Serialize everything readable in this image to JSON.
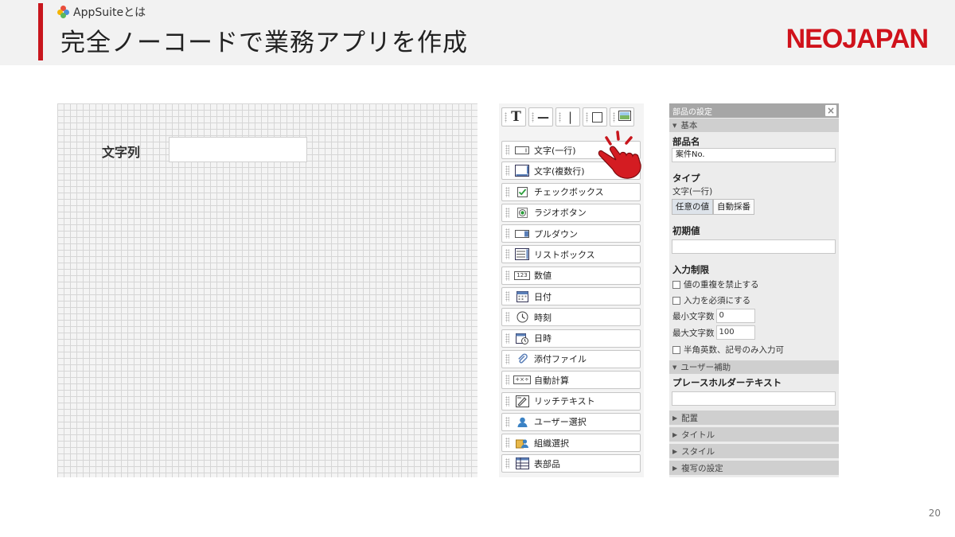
{
  "header": {
    "subtitle": "AppSuiteとは",
    "title": "完全ノーコードで業務アプリを作成",
    "brand": "NEOJAPAN"
  },
  "canvas": {
    "field_label": "文字列",
    "field_value": ""
  },
  "palette": {
    "tools": [
      {
        "name": "text-tool",
        "glyph": "T"
      },
      {
        "name": "hline-tool",
        "glyph": "—"
      },
      {
        "name": "vline-tool",
        "glyph": "|"
      },
      {
        "name": "box-tool",
        "glyph": "□"
      },
      {
        "name": "image-tool",
        "glyph": "▣"
      }
    ],
    "items": [
      {
        "label": "文字(一行)",
        "icon": "single-line-text-icon"
      },
      {
        "label": "文字(複数行)",
        "icon": "multi-line-text-icon"
      },
      {
        "label": "チェックボックス",
        "icon": "checkbox-icon"
      },
      {
        "label": "ラジオボタン",
        "icon": "radio-button-icon"
      },
      {
        "label": "プルダウン",
        "icon": "dropdown-icon"
      },
      {
        "label": "リストボックス",
        "icon": "listbox-icon"
      },
      {
        "label": "数値",
        "icon": "number-icon"
      },
      {
        "label": "日付",
        "icon": "calendar-icon"
      },
      {
        "label": "時刻",
        "icon": "clock-icon"
      },
      {
        "label": "日時",
        "icon": "datetime-icon"
      },
      {
        "label": "添付ファイル",
        "icon": "paperclip-icon"
      },
      {
        "label": "自動計算",
        "icon": "calculator-icon"
      },
      {
        "label": "リッチテキスト",
        "icon": "rich-text-icon"
      },
      {
        "label": "ユーザー選択",
        "icon": "user-icon"
      },
      {
        "label": "組織選択",
        "icon": "organization-icon"
      },
      {
        "label": "表部品",
        "icon": "table-icon"
      }
    ],
    "number_icon_text": "123",
    "calc_icon_text": "+×÷"
  },
  "props": {
    "title": "部品の設定",
    "close": "×",
    "sect_basic": "基本",
    "part_name_label": "部品名",
    "part_name_value": "案件No.",
    "type_label": "タイプ",
    "type_value": "文字(一行)",
    "type_options": [
      "任意の値",
      "自動採番"
    ],
    "initial_label": "初期値",
    "initial_value": "",
    "restrict_label": "入力制限",
    "chk_no_dup": "値の重複を禁止する",
    "chk_required": "入力を必須にする",
    "min_label": "最小文字数",
    "min_value": "0",
    "max_label": "最大文字数",
    "max_value": "100",
    "chk_alnum": "半角英数、記号のみ入力可",
    "sect_assist": "ユーザー補助",
    "placeholder_label": "プレースホルダーテキスト",
    "placeholder_value": "",
    "collapsed": [
      "配置",
      "タイトル",
      "スタイル",
      "複写の設定"
    ]
  },
  "page_number": "20",
  "colors": {
    "accent": "#c8161d",
    "brand": "#d0121b"
  }
}
